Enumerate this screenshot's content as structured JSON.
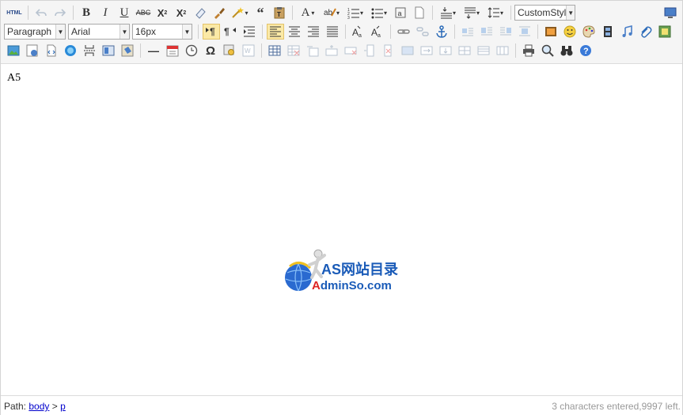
{
  "toolbar": {
    "html_label": "HTML",
    "paragraph": "Paragraph",
    "font_family": "Arial",
    "font_size": "16px",
    "custom_style": "CustomStyl",
    "omega": "Ω"
  },
  "content": {
    "text": "A5"
  },
  "watermark": {
    "line1": "AS网站目录",
    "line2_a": "A",
    "line2_b": "dminSo.com"
  },
  "statusbar": {
    "path_label": "Path:",
    "path_body": "body",
    "path_sep": ">",
    "path_p": "p",
    "count": "3 characters entered,9997 left."
  }
}
